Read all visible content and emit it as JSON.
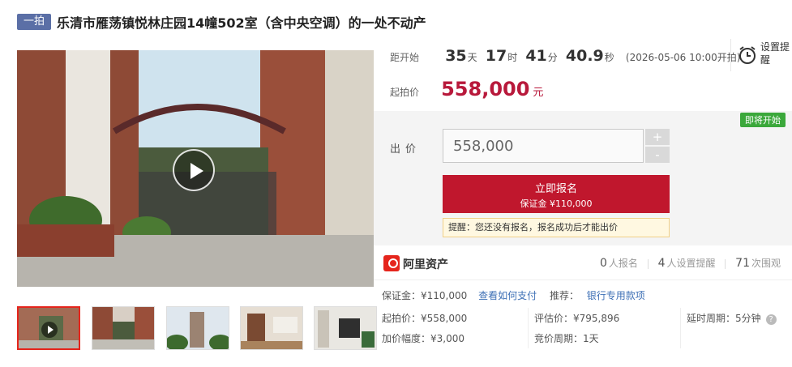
{
  "header": {
    "badge": "一拍",
    "title": "乐清市雁荡镇悦林庄园14幢502室（含中央空调）的一处不动产"
  },
  "countdown": {
    "label": "距开始",
    "days": "35",
    "days_unit": "天",
    "hours": "17",
    "hours_unit": "时",
    "minutes": "41",
    "minutes_unit": "分",
    "seconds": "40.9",
    "seconds_unit": "秒",
    "start_time": "(2026-05-06 10:00开拍)"
  },
  "alarm": {
    "label": "设置提醒",
    "icon": "alarm-clock-icon"
  },
  "starting_price": {
    "label": "起拍价",
    "value": "558,000",
    "unit": "元"
  },
  "bid": {
    "status_tag": "即将开始",
    "label": "出价",
    "input_value": "558,000",
    "plus": "+",
    "minus": "-",
    "signup_label": "立即报名",
    "signup_deposit": "保证金 ¥110,000",
    "tip": "提醒：您还没有报名，报名成功后才能出价"
  },
  "brand": {
    "name": "阿里资产",
    "icon": "ali-asset-logo-icon"
  },
  "stats": {
    "signups": "0",
    "signups_label": "人报名",
    "reminders": "4",
    "reminders_label": "人设置提醒",
    "views": "71",
    "views_label": "次围观"
  },
  "info": {
    "deposit": "保证金：¥110,000",
    "how_to_pay": "查看如何支付",
    "recommend_label": "推荐：",
    "recommend_link": "银行专用款项",
    "start_price": "起拍价：¥558,000",
    "appraisal": "评估价：¥795,896",
    "delay": "延时周期：5分钟",
    "increment": "加价幅度：¥3,000",
    "bid_period": "竞价周期：1天"
  },
  "colors": {
    "accent": "#c0172d",
    "price": "#b8193b",
    "link": "#3d6fb5",
    "badge": "#5b6fa6",
    "tag": "#3ba83b"
  }
}
